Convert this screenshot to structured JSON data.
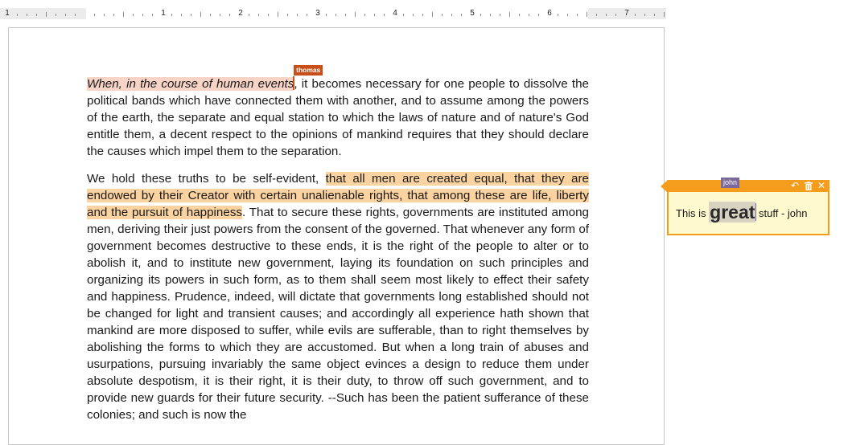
{
  "ruler": {
    "numbers": [
      "1",
      "1",
      "2",
      "3",
      "4",
      "5",
      "6",
      "7"
    ]
  },
  "document": {
    "paragraph1": {
      "highlight": "When, in the course of human events",
      "rest": ", it becomes necessary for one people to dissolve the political bands which have connected them with another, and to assume among the powers of the earth, the separate and equal station to which the laws of nature and of nature's God entitle them, a decent respect to the opinions of mankind requires that they should declare the causes which impel them to the separation."
    },
    "paragraph2": {
      "before": "We hold these truths to be self-evident, ",
      "highlight": "that all men are created equal, that they are endowed by their Creator with certain unalienable rights, that among these are life, liberty and the pursuit of happiness",
      "rest": ". That to secure these rights, governments are instituted among men, deriving their just powers from the consent of the governed. That whenever any form of government becomes destructive to these ends, it is the right of the people to alter or to abolish it, and to institute new government, laying its foundation on such principles and organizing its powers in such form, as to them shall seem most likely to effect their safety and happiness. Prudence, indeed, will dictate that governments long established should not be changed for light and transient causes; and accordingly all experience hath shown that mankind are more disposed to suffer, while evils are sufferable, than to right themselves by abolishing the forms to which they are accustomed. But when a long train of abuses and usurpations, pursuing invariably the same object evinces a design to reduce them under absolute despotism, it is their right, it is their duty, to throw off such government, and to provide new guards for their future security. --Such has been the patient sufferance of these colonies; and such is now the"
    }
  },
  "collaborators": {
    "thomas": {
      "name": "thomas",
      "color": "#c94f1a"
    },
    "john": {
      "name": "john",
      "color": "#7a6a99"
    }
  },
  "comment": {
    "accent_color": "#f49c1c",
    "icons": [
      "reply-icon",
      "trash-icon",
      "close-icon"
    ],
    "text_before": "This is ",
    "text_emphasis": "great",
    "text_after": " stuff - john"
  }
}
